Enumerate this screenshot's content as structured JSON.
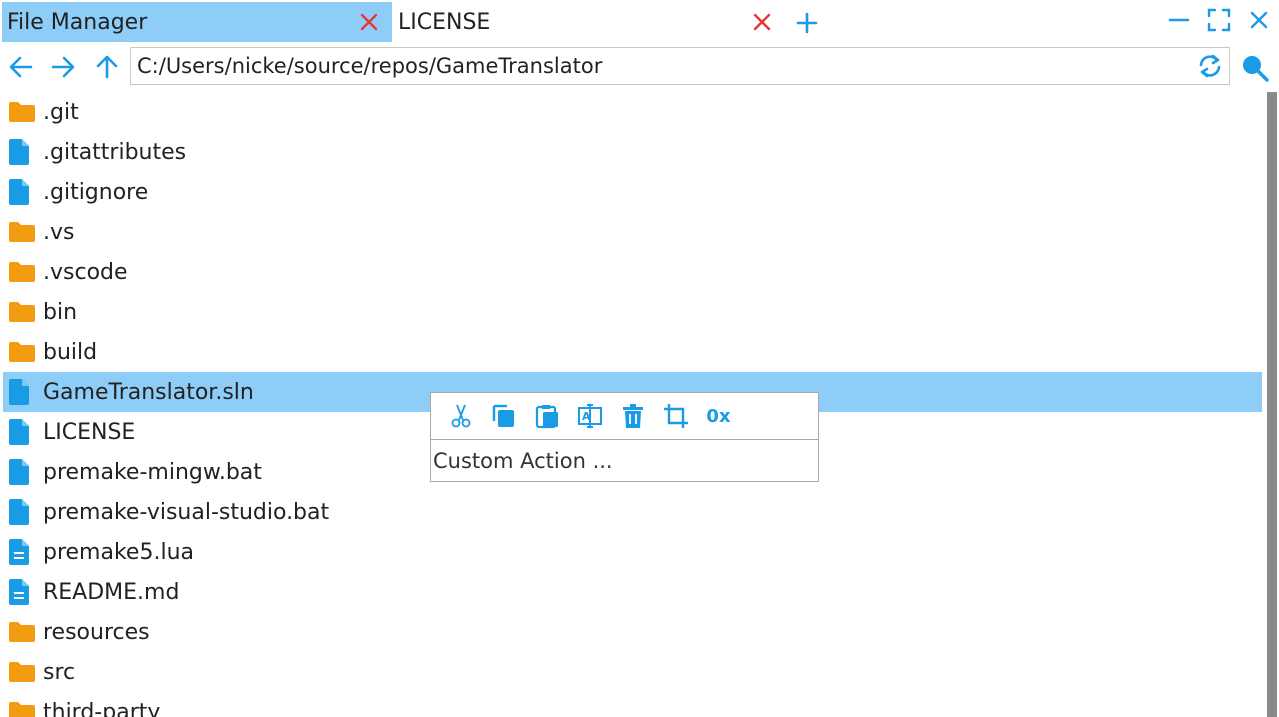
{
  "tabs": [
    {
      "label": "File Manager",
      "active": true
    },
    {
      "label": "LICENSE",
      "active": false
    }
  ],
  "address": {
    "path": "C:/Users/nicke/source/repos/GameTranslator"
  },
  "files": [
    {
      "name": ".git",
      "type": "folder"
    },
    {
      "name": ".gitattributes",
      "type": "file"
    },
    {
      "name": ".gitignore",
      "type": "file"
    },
    {
      "name": ".vs",
      "type": "folder"
    },
    {
      "name": ".vscode",
      "type": "folder"
    },
    {
      "name": "bin",
      "type": "folder"
    },
    {
      "name": "build",
      "type": "folder"
    },
    {
      "name": "GameTranslator.sln",
      "type": "file",
      "selected": true
    },
    {
      "name": "LICENSE",
      "type": "file"
    },
    {
      "name": "premake-mingw.bat",
      "type": "file"
    },
    {
      "name": "premake-visual-studio.bat",
      "type": "file"
    },
    {
      "name": "premake5.lua",
      "type": "text-file"
    },
    {
      "name": "README.md",
      "type": "text-file"
    },
    {
      "name": "resources",
      "type": "folder"
    },
    {
      "name": "src",
      "type": "folder"
    },
    {
      "name": "third-party",
      "type": "folder"
    }
  ],
  "context_menu": {
    "tools": [
      "cut-icon",
      "copy-icon",
      "paste-icon",
      "rename-icon",
      "delete-icon",
      "crop-icon",
      "hex-icon"
    ],
    "hex_label": "0x",
    "custom_action": "Custom Action ..."
  },
  "colors": {
    "accent": "#1a9be6",
    "selection": "#8ecdf7",
    "folder": "#f39c12",
    "close": "#e53935"
  }
}
